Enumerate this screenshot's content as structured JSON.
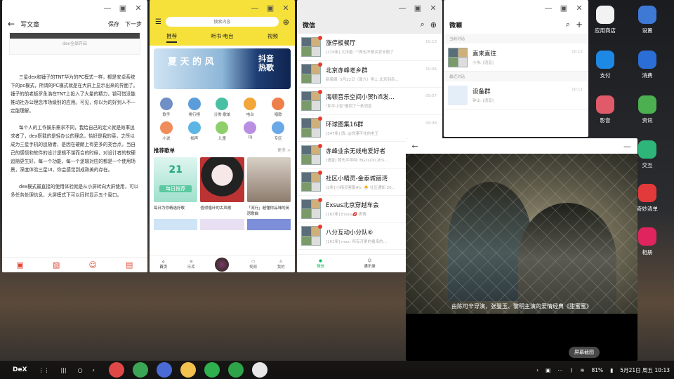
{
  "doc_window": {
    "title": "写文章",
    "save_label": "保存",
    "next_label": "下一步",
    "caption": "dex全部开启",
    "paragraphs": [
      "三星dex和锤子的TNT华为的PC模式一样，都是安卓系统下的pc模式，所谓的PC模式就是在大屏上显示出来的界面了。锤子的前老板罗永浩在TNT上投入了大量的精力，锁可惜没能推动社办公理念市场级别的应用。可见，你以为的好到人不一定能理解。",
      "每个人的工作娱乐需求不同，我给自己的定义就是效率追求者了，dex搭载的是轻办公的理念，恰好是我的菜，之所以成为三星手机的追随者，是因在硬朗上有更多的契合点，当自己的感悟和软件的设计逻辑不谋而合的时候，对设计者的软硬追随更生好，每一个功能，每一个逻辑对应的都是一个使用场景，深度体验三星UI，你会感觉到成熟美的存在。",
      "dex模式最直接的使用体验就是从小屏转向大屏使用，可以多任务处理信息，大屏模式下可以同时显示五个窗口。"
    ],
    "bottom_icons": [
      "text-icon",
      "image-icon",
      "emoji-icon",
      "shop-icon"
    ]
  },
  "music_window": {
    "search_placeholder": "搜索内容",
    "tabs": [
      "推荐",
      "听书·电台",
      "视频"
    ],
    "banner_left": "夏 天 的 风",
    "banner_right": "抖音热歌",
    "grid": [
      {
        "label": "歌手",
        "color": "#6f8fc6"
      },
      {
        "label": "排行榜",
        "color": "#5b9ddb"
      },
      {
        "label": "分类·歌单",
        "color": "#48c0a3"
      },
      {
        "label": "电台",
        "color": "#f1a53a"
      },
      {
        "label": "唱歌",
        "color": "#ef7f4a"
      },
      {
        "label": "小说",
        "color": "#f08c5a"
      },
      {
        "label": "相声",
        "color": "#5bb6e5"
      },
      {
        "label": "儿童",
        "color": "#8fcf6b"
      },
      {
        "label": "DJ",
        "color": "#b98fe3"
      },
      {
        "label": "专区",
        "color": "#6aa8e8"
      }
    ],
    "section_title": "推荐歌单",
    "section_more": "更多 >",
    "cards": [
      {
        "title": "每日为你精选好歌",
        "day": "21",
        "label": "每日推荐"
      },
      {
        "title": "值得循环的古风歌",
        "day": "",
        "label": ""
      },
      {
        "title": "「流行」超懂你品味的英语歌曲",
        "day": "",
        "label": ""
      }
    ],
    "nav": [
      "首页",
      "乐库",
      "",
      "视频",
      "我的"
    ]
  },
  "wechat_window": {
    "title": "微信",
    "chats": [
      {
        "name": "涨停板餐厅",
        "msg": "[219条] 大洋墨: \"\"再也不想买农业股了",
        "time": "10:13"
      },
      {
        "name": "北京赤峰老乡群",
        "msg": "新荣阁: 5月22日（周六）早上 北京到赤...",
        "time": "10:06"
      },
      {
        "name": "海顿音乐空间小贺hifi发...",
        "msg": "\"和平小宝\"撤回了一条消息",
        "time": "09:57"
      },
      {
        "name": "环球图集16群",
        "msg": "[347条] 西: @你漂不住的老王",
        "time": "09:38"
      },
      {
        "name": "赤峰业余无线电爱好者",
        "msg": "[语音] 茸先平呼叫: BG3LOO 决斗...",
        "time": ""
      },
      {
        "name": "社区小精灵-金泰城丽湾",
        "msg": "[2条] 小精灵客服#1: 🐣 社区通知 20...",
        "time": ""
      },
      {
        "name": "Exsus北京穿越车会",
        "msg": "[163条] Exsus💋 表情",
        "time": ""
      },
      {
        "name": "八分互动小分队⑥",
        "msg": "[161条] max: 所有开更的看来的...",
        "time": ""
      }
    ],
    "nav": [
      "微信",
      "通讯录",
      "发现"
    ]
  },
  "weibo_window": {
    "title": "微唰",
    "sec1": "当前对话",
    "sec2": "最近对话",
    "items": [
      {
        "name": "直来直往",
        "sub": "小伟: [语音]",
        "time": "10:12"
      },
      {
        "name": "设备群",
        "sub": "钟山: [语音]",
        "time": "10:11"
      }
    ]
  },
  "video_window": {
    "subtitle": "由陈可辛导演，张曼玉、黎明主演的爱情经典《甜蜜蜜》"
  },
  "desktop_icons": [
    {
      "label": "应用商店",
      "color": "#f2f2f2"
    },
    {
      "label": "设置",
      "color": "#3f79d6"
    },
    {
      "label": "支付",
      "color": "#1e88e5"
    },
    {
      "label": "消费",
      "color": "#2b6ed6"
    },
    {
      "label": "影音",
      "color": "#e05a6a"
    },
    {
      "label": "资讯",
      "color": "#4caf50"
    },
    {
      "label": "交互",
      "color": "#2db57a"
    },
    {
      "label": "奇妙清单",
      "color": "#e23a3a"
    },
    {
      "label": "相册",
      "color": "#e0245e"
    }
  ],
  "taskbar": {
    "dex_label": "DeX",
    "battery": "81%",
    "date_time": "5月21日 周五 10:13",
    "toast": "屏幕截图",
    "apps": [
      "#e04848",
      "#3aa655",
      "#4a6ad6",
      "#f2c14e",
      "#2fb04e",
      "#2ea34a",
      "#e8e8e8"
    ]
  }
}
